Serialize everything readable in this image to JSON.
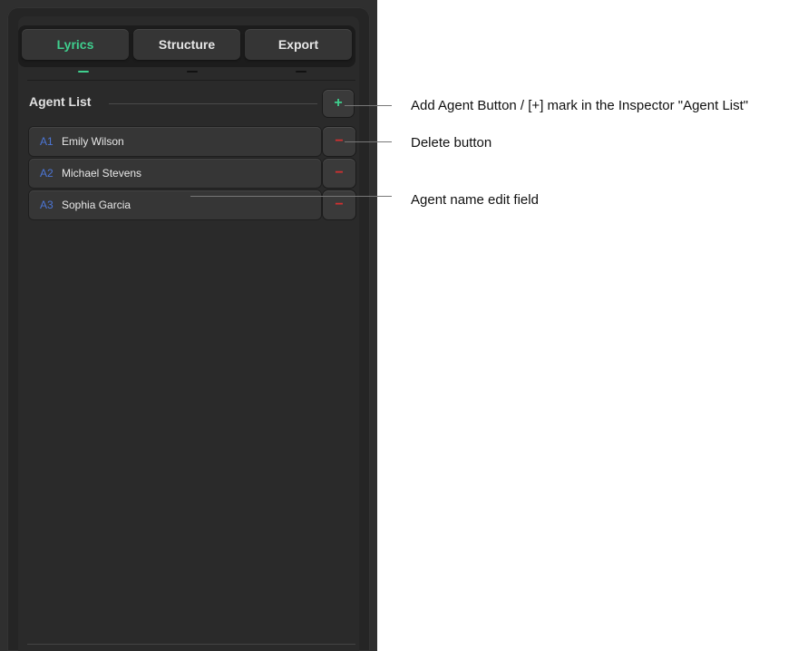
{
  "tabs": [
    {
      "label": "Lyrics",
      "active": true
    },
    {
      "label": "Structure",
      "active": false
    },
    {
      "label": "Export",
      "active": false
    }
  ],
  "agent_list": {
    "title": "Agent List",
    "add_button": "+",
    "delete_button": "−",
    "agents": [
      {
        "id": "A1",
        "name": "Emily Wilson"
      },
      {
        "id": "A2",
        "name": "Michael Stevens"
      },
      {
        "id": "A3",
        "name": "Sophia Garcia"
      }
    ]
  },
  "callouts": {
    "add_agent": "Add Agent Button / [+] mark in the Inspector \"Agent List\"",
    "delete": "Delete button",
    "name_field": "Agent name edit field"
  },
  "colors": {
    "accent_green": "#3fcf8e",
    "delete_red": "#d23030",
    "agent_id_blue": "#4c76d6",
    "panel_bg": "#2a2a2a"
  },
  "icons": {
    "add": "plus-icon",
    "delete": "minus-icon"
  }
}
